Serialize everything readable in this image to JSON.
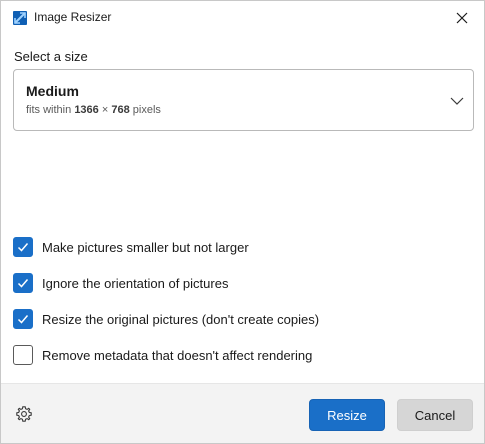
{
  "window": {
    "title": "Image Resizer",
    "app_icon": "image-resizer-icon",
    "close_icon": "close-icon"
  },
  "size_section": {
    "label": "Select a size",
    "selected": {
      "name": "Medium",
      "desc_prefix": "fits within",
      "width": "1366",
      "times": "×",
      "height": "768",
      "unit": "pixels"
    },
    "chevron_icon": "chevron-down-icon"
  },
  "options": [
    {
      "label": "Make pictures smaller but not larger",
      "checked": true
    },
    {
      "label": "Ignore the orientation of pictures",
      "checked": true
    },
    {
      "label": "Resize the original pictures (don't create copies)",
      "checked": true
    },
    {
      "label": "Remove metadata that doesn't affect rendering",
      "checked": false
    }
  ],
  "footer": {
    "settings_icon": "gear-icon",
    "resize_label": "Resize",
    "cancel_label": "Cancel"
  },
  "colors": {
    "accent": "#1a6fc8",
    "footer_bg": "#f3f3f3",
    "cancel_bg": "#d6d6d6"
  }
}
